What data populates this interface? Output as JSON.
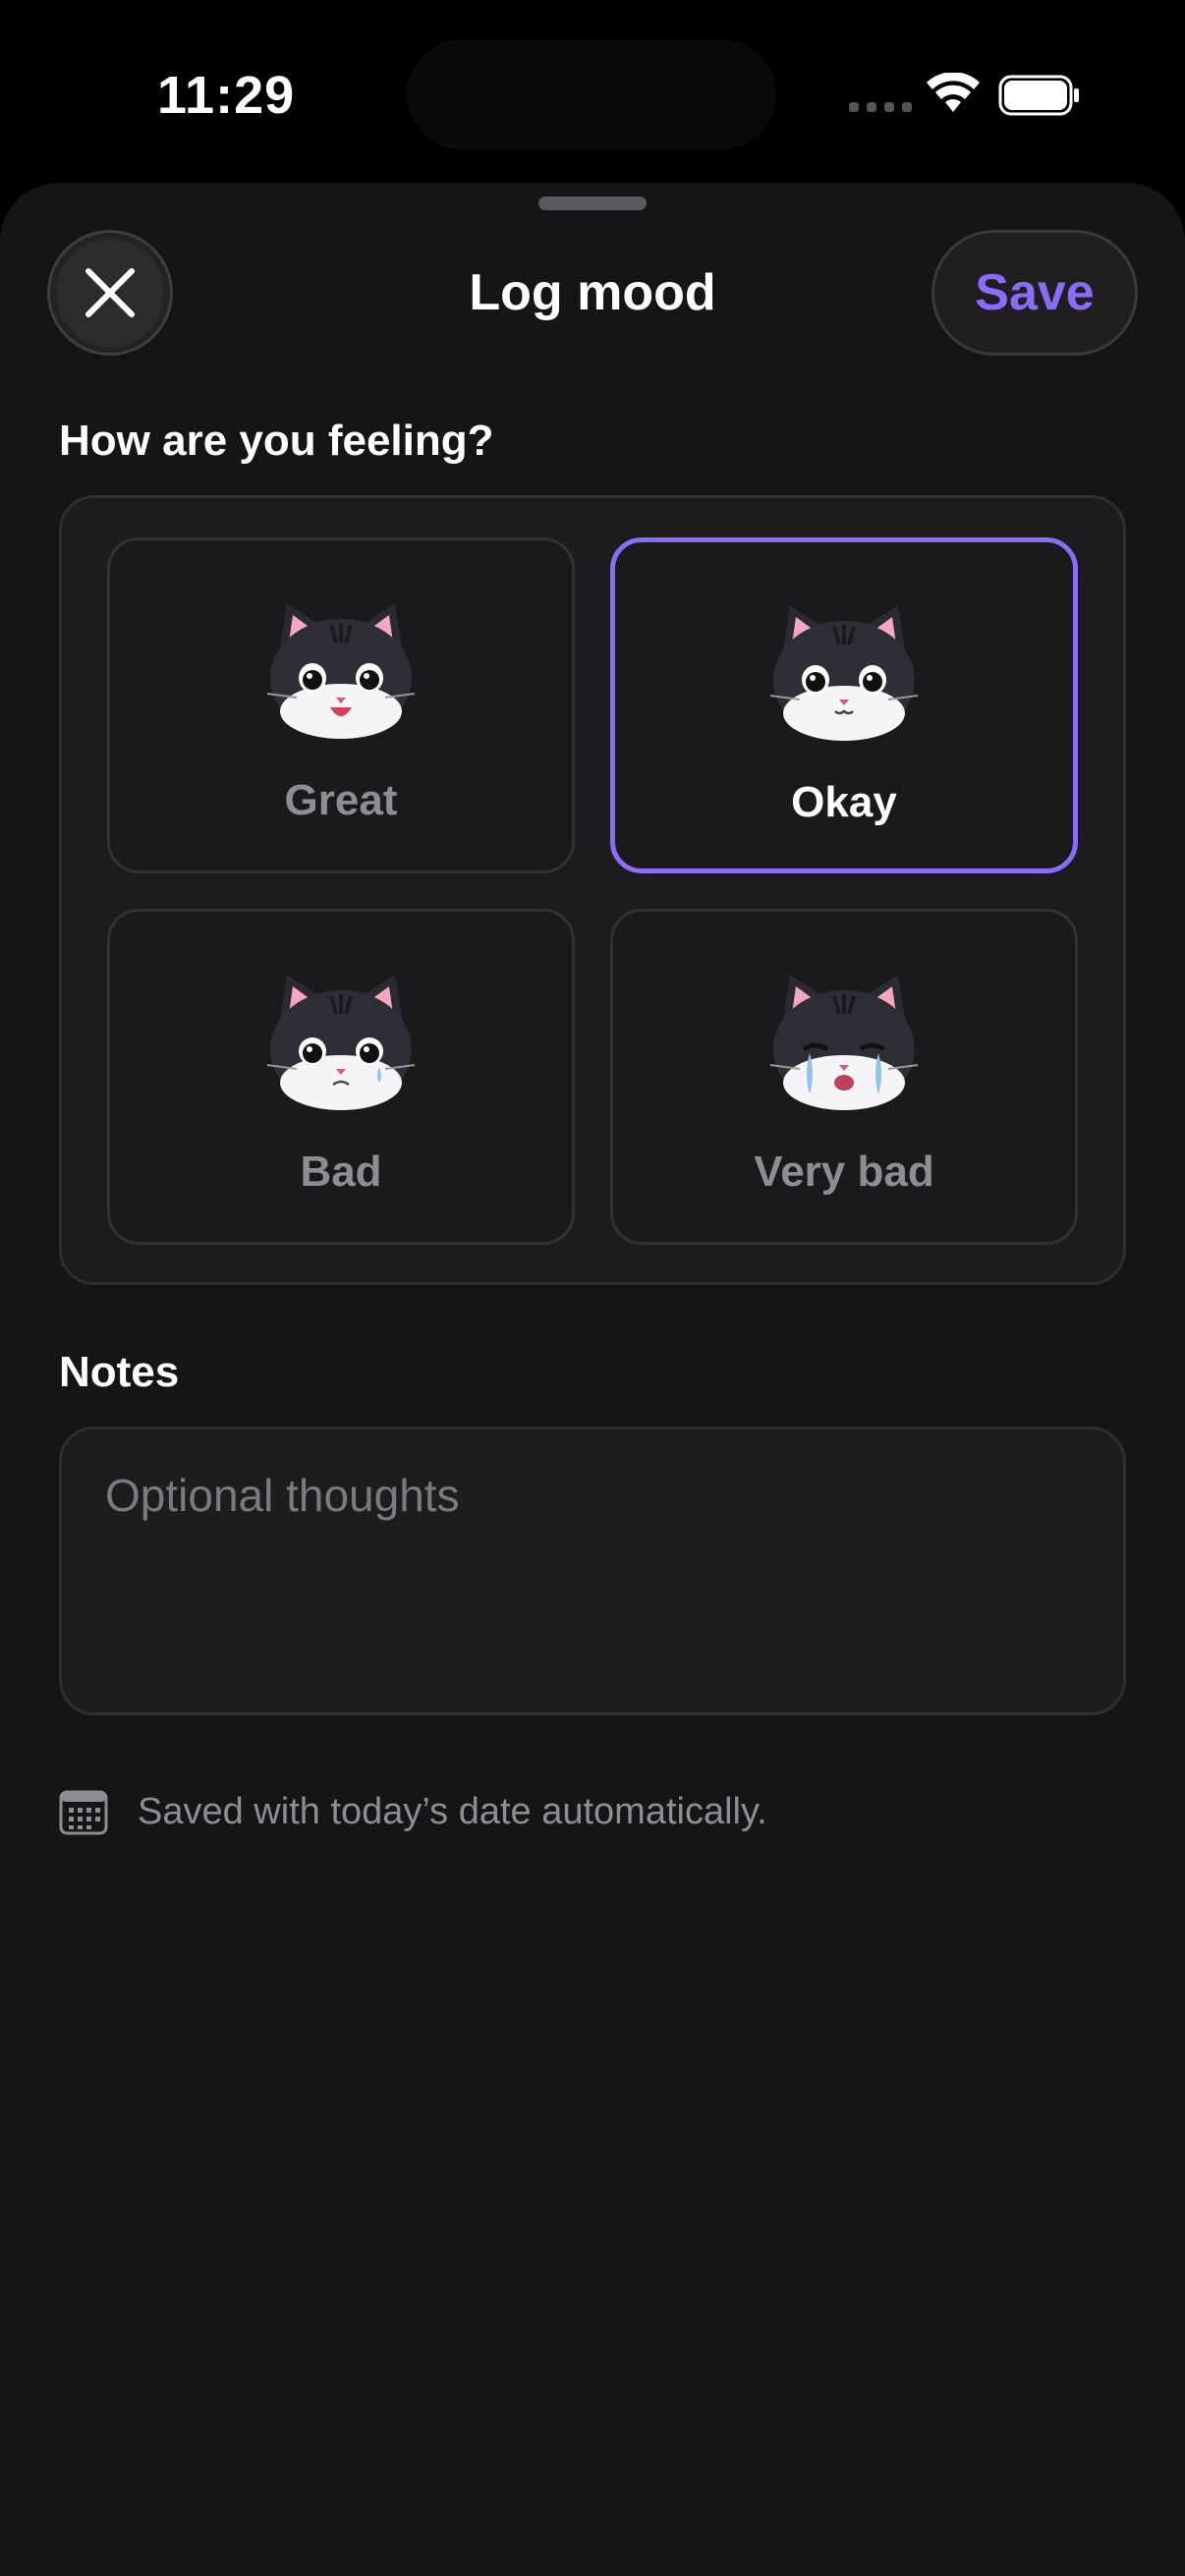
{
  "status_bar": {
    "time": "11:29"
  },
  "header": {
    "title": "Log mood",
    "close_icon": "close-icon",
    "save_label": "Save"
  },
  "mood_section": {
    "label": "How are you feeling?",
    "selected": "Okay",
    "options": [
      {
        "label": "Great",
        "icon": "cat-great-icon"
      },
      {
        "label": "Okay",
        "icon": "cat-okay-icon"
      },
      {
        "label": "Bad",
        "icon": "cat-bad-icon"
      },
      {
        "label": "Very bad",
        "icon": "cat-very-bad-icon"
      }
    ]
  },
  "notes": {
    "label": "Notes",
    "placeholder": "Optional thoughts",
    "value": ""
  },
  "footnote": {
    "icon": "calendar-icon",
    "text": "Saved with today’s date automatically."
  },
  "colors": {
    "accent": "#8b6cf6",
    "background": "#151517",
    "card": "#1c1c1e",
    "muted_text": "#8d8d92"
  }
}
